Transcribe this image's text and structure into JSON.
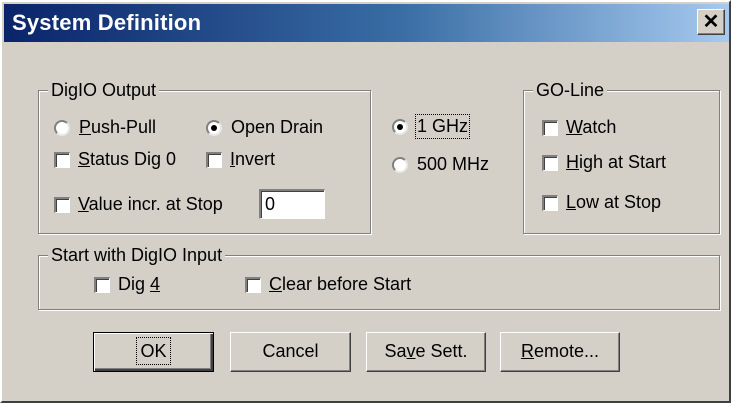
{
  "window": {
    "title": "System Definition",
    "close_glyph": "✕"
  },
  "digio_output": {
    "legend": "DigIO Output",
    "push_pull": {
      "prefix": "",
      "accel": "P",
      "rest": "ush-Pull",
      "checked": false
    },
    "open_drain": {
      "label": "Open Drain",
      "checked": true
    },
    "status_dig0": {
      "prefix": "",
      "accel": "S",
      "rest": "tatus Dig 0",
      "checked": false
    },
    "invert": {
      "prefix": "",
      "accel": "I",
      "rest": "nvert",
      "checked": false
    },
    "value_incr": {
      "prefix": "",
      "accel": "V",
      "rest": "alue incr. at Stop",
      "checked": false
    },
    "value_field": "0"
  },
  "clock": {
    "ghz": {
      "label": "1 GHz",
      "checked": true
    },
    "mhz": {
      "label": "500 MHz",
      "checked": false
    }
  },
  "go_line": {
    "legend": "GO-Line",
    "watch": {
      "prefix": "",
      "accel": "W",
      "rest": "atch",
      "checked": false
    },
    "high_at_start": {
      "prefix": "",
      "accel": "H",
      "rest": "igh at Start",
      "checked": false
    },
    "low_at_stop": {
      "prefix": "",
      "accel": "L",
      "rest": "ow at Stop",
      "checked": false
    }
  },
  "start_input": {
    "legend": "Start with DigIO Input",
    "dig4": {
      "prefix": "Dig ",
      "accel": "4",
      "rest": "",
      "checked": false
    },
    "clear": {
      "prefix": "",
      "accel": "C",
      "rest": "lear before Start",
      "checked": false
    }
  },
  "buttons": {
    "ok": "OK",
    "cancel": "Cancel",
    "save": {
      "prefix": "Sa",
      "accel": "v",
      "rest": "e Sett."
    },
    "remote": {
      "prefix": "",
      "accel": "R",
      "rest": "emote..."
    }
  },
  "icons": {
    "close": "close-icon",
    "radio": "radio-icon",
    "checkbox": "checkbox-icon"
  },
  "colors": {
    "face": "#d4d0c8",
    "title_start": "#0a246a",
    "title_end": "#a6caf0"
  }
}
